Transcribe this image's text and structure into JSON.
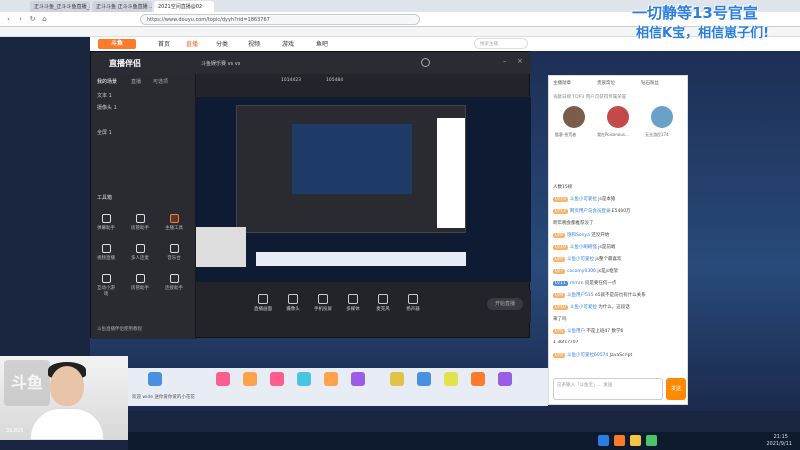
{
  "browser": {
    "tabs": [
      "正斗斗鱼_正斗斗鱼直播_斗鱼...",
      "正斗斗鱼 正斗斗鱼直播 ...",
      "2021空间直播@02"
    ],
    "url": "https://www.douyu.com/topic/dyyh?rid=1863767"
  },
  "overlay": {
    "line1": "一切静等13号官宣",
    "line2": "相信K宝，相信崽子们!"
  },
  "douyu": {
    "nav": [
      "首页",
      "直播",
      "分类",
      "视频",
      "游戏",
      "鱼吧"
    ],
    "active_nav": "直播",
    "search_placeholder": "搜索主播"
  },
  "companion": {
    "title": "直播伴侣",
    "scene_title": "我的场景",
    "tab1": "直播",
    "tab2": "可选项",
    "room_title": "斗鱼娱乐赛 vs vs",
    "stats1": "1014423",
    "stats2": "105484",
    "sources": [
      "文本 1",
      "摄像头 1",
      "全屏 1"
    ],
    "tools_header": "工具箱",
    "tools": [
      "弹幕助手",
      "房管助手",
      "主播工具",
      "视频直播",
      "多人连麦",
      "音乐台",
      "互动小游戏",
      "房管助手",
      "连接助手",
      "互动玩法",
      "鱼吧管理",
      "工具"
    ],
    "bottom_buttons": [
      "直播画面",
      "摄像头",
      "手机投屏",
      "多媒体",
      "麦克风",
      "扬声器"
    ],
    "golive": "开始直播",
    "footer_note": "斗鱼直播伴侣使用教程"
  },
  "chat": {
    "tabs": [
      "主播勋章",
      "贵族席位",
      "钻石粉丝"
    ],
    "header": "贡献日榜 TOP3 用户可获得专属荣誉",
    "top_users": [
      "酷客·拾荒者",
      "我在Poisonous...",
      "无业游民174"
    ],
    "count_label": "人数15榜",
    "messages": [
      {
        "lvl": "LV15",
        "user": "斗鱼小可爱拉",
        "text": "js是本猿"
      },
      {
        "lvl": "LV12",
        "user": "网页用户与会员登录",
        "text": "E5400万"
      },
      {
        "lvl": "",
        "user": "",
        "text": "跨年晚会都推荐没了"
      },
      {
        "lvl": "LV8",
        "user": "饱和Sonya",
        "text": "还没开始"
      },
      {
        "lvl": "LV10",
        "user": "斗鱼小刷刷怪",
        "text": "js是前端"
      },
      {
        "lvl": "LV9",
        "user": "斗鱼小可爱拉",
        "text": "js整个最喜欢"
      },
      {
        "lvl": "LV7",
        "user": "cocomy0306",
        "text": "js是js框架"
      },
      {
        "lvl": "LV11",
        "user": "mrnrn",
        "text": "问是要任何一点"
      },
      {
        "lvl": "LV9",
        "user": "斗鱼用户515",
        "text": "e5就不是前也有什么关系"
      },
      {
        "lvl": "LV10",
        "user": "斗鱼小可爱拉",
        "text": "为什么，这段话"
      },
      {
        "lvl": "",
        "user": "",
        "text": "来了吗"
      },
      {
        "lvl": "LV6",
        "user": "斗鱼用户",
        "text": "不是上班47 数学6"
      },
      {
        "lvl": "",
        "user": "",
        "text": "1 3bfc7707"
      },
      {
        "lvl": "LV8",
        "user": "斗鱼小可爱拉60574",
        "text": "JavaScript"
      }
    ],
    "input_placeholder": "这条输入「斗鱼宝」... 发送",
    "send_label": "发送"
  },
  "giftbar": {
    "welcome": "欢迎 wide 送你爱你爱的小花花"
  },
  "webcam": {
    "logo": "斗鱼",
    "caption": "39,825"
  },
  "taskbar": {
    "time": "21:15",
    "date": "2021/9/11"
  }
}
